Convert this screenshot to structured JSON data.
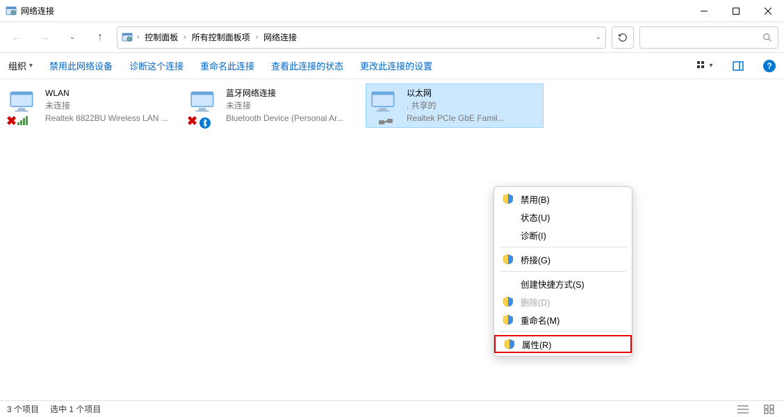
{
  "window": {
    "title": "网络连接"
  },
  "breadcrumb": {
    "items": [
      "控制面板",
      "所有控制面板项",
      "网络连接"
    ]
  },
  "commandbar": {
    "organize": "组织",
    "items": [
      "禁用此网络设备",
      "诊断这个连接",
      "重命名此连接",
      "查看此连接的状态",
      "更改此连接的设置"
    ]
  },
  "adapters": [
    {
      "name": "WLAN",
      "status": "未连接",
      "device": "Realtek 8822BU Wireless LAN ..."
    },
    {
      "name": "蓝牙网络连接",
      "status": "未连接",
      "device": "Bluetooth Device (Personal Ar..."
    },
    {
      "name": "以太网",
      "status": ", 共享的",
      "device": "Realtek PCIe GbE Famil..."
    }
  ],
  "context_menu": {
    "disable": "禁用(B)",
    "status": "状态(U)",
    "diagnose": "诊断(I)",
    "bridge": "桥接(G)",
    "shortcut": "创建快捷方式(S)",
    "delete": "删除(D)",
    "rename": "重命名(M)",
    "properties": "属性(R)"
  },
  "statusbar": {
    "count": "3 个项目",
    "selection": "选中 1 个项目"
  }
}
